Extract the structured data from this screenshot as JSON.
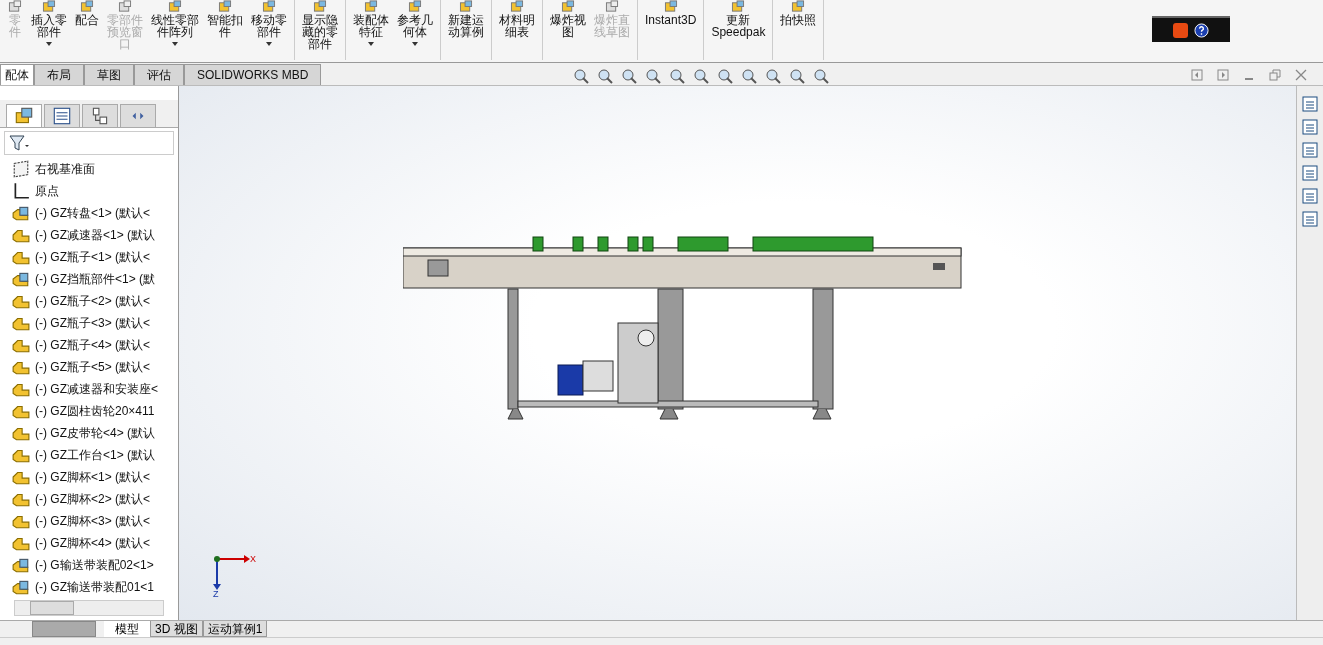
{
  "toolbar": {
    "groups": [
      {
        "items": [
          {
            "lines": [
              "零",
              "件"
            ],
            "disabled": true,
            "caret": false
          },
          {
            "lines": [
              "插入零",
              "部件"
            ],
            "disabled": false,
            "caret": true
          },
          {
            "lines": [
              "配合"
            ],
            "disabled": false,
            "caret": false
          },
          {
            "lines": [
              "零部件",
              "预览窗",
              "口"
            ],
            "disabled": true,
            "caret": false
          },
          {
            "lines": [
              "线性零部",
              "件阵列"
            ],
            "disabled": false,
            "caret": true
          },
          {
            "lines": [
              "智能扣",
              "件"
            ],
            "disabled": false,
            "caret": false
          },
          {
            "lines": [
              "移动零",
              "部件"
            ],
            "disabled": false,
            "caret": true
          }
        ]
      },
      {
        "items": [
          {
            "lines": [
              "显示隐",
              "藏的零",
              "部件"
            ],
            "disabled": false,
            "caret": false
          }
        ]
      },
      {
        "items": [
          {
            "lines": [
              "装配体",
              "特征"
            ],
            "disabled": false,
            "caret": true
          },
          {
            "lines": [
              "参考几",
              "何体"
            ],
            "disabled": false,
            "caret": true
          }
        ]
      },
      {
        "items": [
          {
            "lines": [
              "新建运",
              "动算例"
            ],
            "disabled": false,
            "caret": false
          }
        ]
      },
      {
        "items": [
          {
            "lines": [
              "材料明",
              "细表"
            ],
            "disabled": false,
            "caret": false
          }
        ]
      },
      {
        "items": [
          {
            "lines": [
              "爆炸视",
              "图"
            ],
            "disabled": false,
            "caret": false
          },
          {
            "lines": [
              "爆炸直",
              "线草图"
            ],
            "disabled": true,
            "caret": false
          }
        ]
      },
      {
        "items": [
          {
            "lines": [
              "Instant3D"
            ],
            "disabled": false,
            "caret": false
          }
        ]
      },
      {
        "items": [
          {
            "lines": [
              "更新",
              "Speedpak"
            ],
            "disabled": false,
            "caret": false
          }
        ]
      },
      {
        "items": [
          {
            "lines": [
              "拍快照"
            ],
            "disabled": false,
            "caret": false
          }
        ]
      }
    ]
  },
  "command_tabs": [
    {
      "label": "配体",
      "selected": true
    },
    {
      "label": "布局",
      "selected": false
    },
    {
      "label": "草图",
      "selected": false
    },
    {
      "label": "评估",
      "selected": false
    },
    {
      "label": "SOLIDWORKS MBD",
      "selected": false
    }
  ],
  "feature_tree": {
    "items": [
      {
        "kind": "plane",
        "label": "右视基准面"
      },
      {
        "kind": "origin",
        "label": "原点"
      },
      {
        "kind": "assembly",
        "label": "(-) GZ转盘<1> (默认<"
      },
      {
        "kind": "part",
        "label": "(-) GZ减速器<1> (默认"
      },
      {
        "kind": "part",
        "label": "(-) GZ瓶子<1> (默认<"
      },
      {
        "kind": "assembly",
        "label": "(-) GZ挡瓶部件<1> (默"
      },
      {
        "kind": "part",
        "label": "(-) GZ瓶子<2> (默认<"
      },
      {
        "kind": "part",
        "label": "(-) GZ瓶子<3> (默认<"
      },
      {
        "kind": "part",
        "label": "(-) GZ瓶子<4> (默认<"
      },
      {
        "kind": "part",
        "label": "(-) GZ瓶子<5> (默认<"
      },
      {
        "kind": "part",
        "label": "(-) GZ减速器和安装座<"
      },
      {
        "kind": "part",
        "label": "(-) GZ圆柱齿轮20×411"
      },
      {
        "kind": "part",
        "label": "(-) GZ皮带轮<4> (默认"
      },
      {
        "kind": "part",
        "label": "(-) GZ工作台<1> (默认"
      },
      {
        "kind": "part",
        "label": "(-) GZ脚杯<1> (默认<"
      },
      {
        "kind": "part",
        "label": "(-) GZ脚杯<2> (默认<"
      },
      {
        "kind": "part",
        "label": "(-) GZ脚杯<3> (默认<"
      },
      {
        "kind": "part",
        "label": "(-) GZ脚杯<4> (默认<"
      },
      {
        "kind": "assembly",
        "label": "(-) G输送带装配02<1>"
      },
      {
        "kind": "assembly",
        "label": "(-) GZ输送带装配01<1"
      }
    ]
  },
  "triad": {
    "x_label": "X",
    "z_label": "Z"
  },
  "bottom_tabs": [
    {
      "label": "模型",
      "selected": true
    },
    {
      "label": "3D 视图",
      "selected": false
    },
    {
      "label": "运动算例1",
      "selected": false
    }
  ]
}
